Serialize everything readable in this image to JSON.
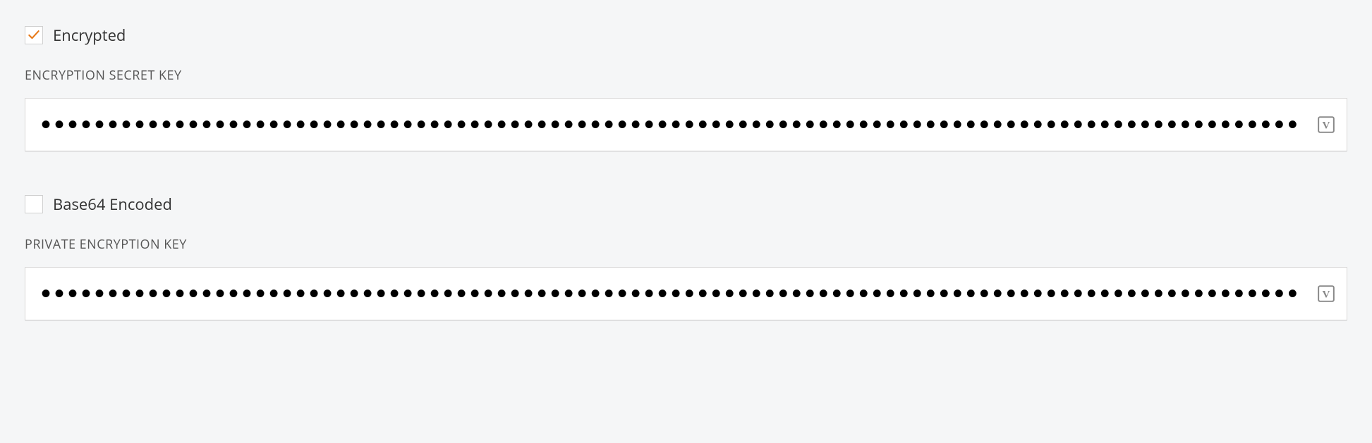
{
  "encrypted": {
    "label": "Encrypted",
    "checked": true
  },
  "encryption_secret_key": {
    "label": "ENCRYPTION SECRET KEY",
    "value": "•••••••••••••••••••••••••••••••••••••••••••••••••••••••••••••••••••••••••••••••••••••••••••••••••••••••••••••••••••"
  },
  "base64_encoded": {
    "label": "Base64 Encoded",
    "checked": false
  },
  "private_encryption_key": {
    "label": "PRIVATE ENCRYPTION KEY",
    "value": "•••••••••••••••••••••••••••••••••••••••••••••••••••••••••••••••••••••••••••••••••••••••••••••••••••••••••••••••••••"
  }
}
